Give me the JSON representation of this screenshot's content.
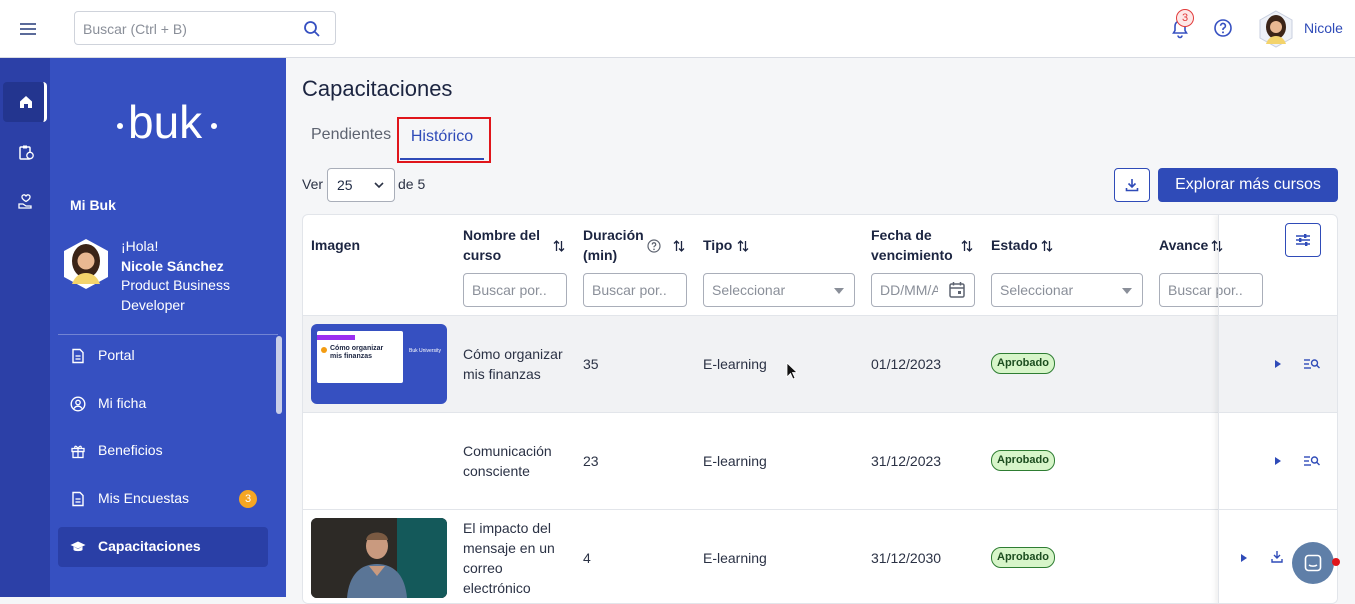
{
  "header": {
    "search_placeholder": "Buscar (Ctrl + B)",
    "notifications_count": "3",
    "user_name": "Nicole"
  },
  "sidebar": {
    "section_title": "Mi Buk",
    "greeting": "¡Hola!",
    "user_full_name": "Nicole Sánchez",
    "user_role": "Product Business Developer",
    "items": [
      {
        "label": "Portal",
        "icon": "document-icon"
      },
      {
        "label": "Mi ficha",
        "icon": "user-circle-icon"
      },
      {
        "label": "Beneficios",
        "icon": "gift-icon"
      },
      {
        "label": "Mis Encuestas",
        "icon": "document-icon",
        "badge": "3"
      },
      {
        "label": "Capacitaciones",
        "icon": "graduation-cap-icon",
        "active": true
      }
    ]
  },
  "page": {
    "title": "Capacitaciones",
    "tabs": [
      "Pendientes",
      "Histórico"
    ],
    "active_tab": "Histórico",
    "ver_label": "Ver",
    "per_page": "25",
    "of_total": "de 5",
    "explore_button": "Explorar más cursos"
  },
  "table": {
    "headers": {
      "image": "Imagen",
      "name": "Nombre del curso",
      "duration": "Duración (min)",
      "type": "Tipo",
      "due_date": "Fecha de vencimiento",
      "status": "Estado",
      "progress": "Avance"
    },
    "filters": {
      "name_placeholder": "Buscar por..",
      "duration_placeholder": "Buscar por..",
      "type_placeholder": "Seleccionar",
      "date_placeholder": "DD/MM/AAAA",
      "status_placeholder": "Seleccionar",
      "progress_placeholder": "Buscar por.."
    },
    "rows": [
      {
        "name": "Cómo organizar mis finanzas",
        "duration": "35",
        "type": "E-learning",
        "due_date": "01/12/2023",
        "status": "Aprobado",
        "thumb_title": "Cómo organizar mis finanzas",
        "thumb_brand": "Buk University"
      },
      {
        "name": "Comunicación consciente",
        "duration": "23",
        "type": "E-learning",
        "due_date": "31/12/2023",
        "status": "Aprobado"
      },
      {
        "name": "El impacto del mensaje en un correo electrónico",
        "duration": "4",
        "type": "E-learning",
        "due_date": "31/12/2030",
        "status": "Aprobado"
      }
    ]
  },
  "colors": {
    "brand_blue": "#2f4bb8",
    "sidebar_blue": "#3650c1",
    "rail_blue": "#2c40a7",
    "status_green": "#d7f5c9",
    "highlight_red": "#e0151b"
  }
}
